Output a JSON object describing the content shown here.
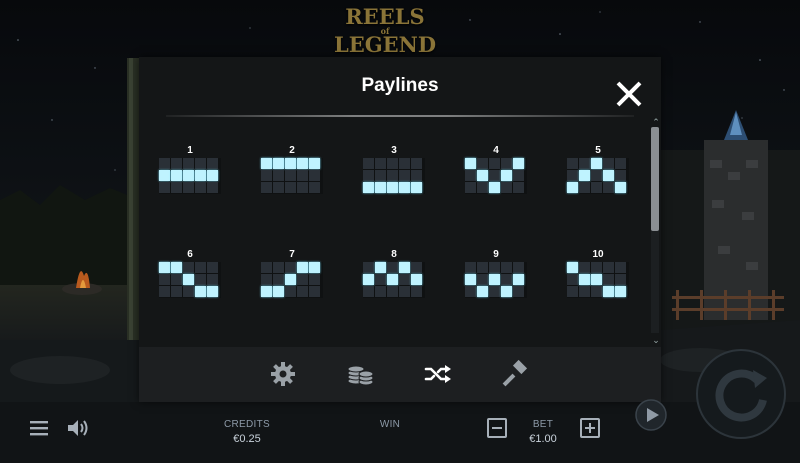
{
  "game": {
    "logo_line1": "REELS",
    "logo_line2": "of",
    "logo_line3": "LEGEND"
  },
  "modal": {
    "title": "Paylines",
    "close_icon": "close-icon",
    "paylines": [
      {
        "number": "1",
        "pattern": [
          1,
          1,
          1,
          1,
          1
        ]
      },
      {
        "number": "2",
        "pattern": [
          0,
          0,
          0,
          0,
          0
        ]
      },
      {
        "number": "3",
        "pattern": [
          2,
          2,
          2,
          2,
          2
        ]
      },
      {
        "number": "4",
        "pattern": [
          0,
          1,
          2,
          1,
          0
        ]
      },
      {
        "number": "5",
        "pattern": [
          2,
          1,
          0,
          1,
          2
        ]
      },
      {
        "number": "6",
        "pattern": [
          0,
          0,
          1,
          2,
          2
        ]
      },
      {
        "number": "7",
        "pattern": [
          2,
          2,
          1,
          0,
          0
        ]
      },
      {
        "number": "8",
        "pattern": [
          1,
          0,
          1,
          0,
          1
        ]
      },
      {
        "number": "9",
        "pattern": [
          1,
          2,
          1,
          2,
          1
        ]
      },
      {
        "number": "10",
        "pattern": [
          0,
          1,
          1,
          2,
          2
        ]
      }
    ],
    "tabs": [
      {
        "name": "settings",
        "icon": "gear-icon"
      },
      {
        "name": "bet",
        "icon": "coins-icon"
      },
      {
        "name": "paylines",
        "icon": "shuffle-icon",
        "active": true
      },
      {
        "name": "rules",
        "icon": "gavel-icon"
      }
    ]
  },
  "bottom_bar": {
    "credits_label": "CREDITS",
    "credits_value": "€0.25",
    "win_label": "WIN",
    "bet_label": "BET",
    "bet_value": "€1.00"
  },
  "colors": {
    "panel_bg": "#141617",
    "payline_on": "#bff3ff",
    "payline_off": "#2a3037",
    "tab_bar_bg": "#1d1f21",
    "label": "#8d9aa8"
  }
}
